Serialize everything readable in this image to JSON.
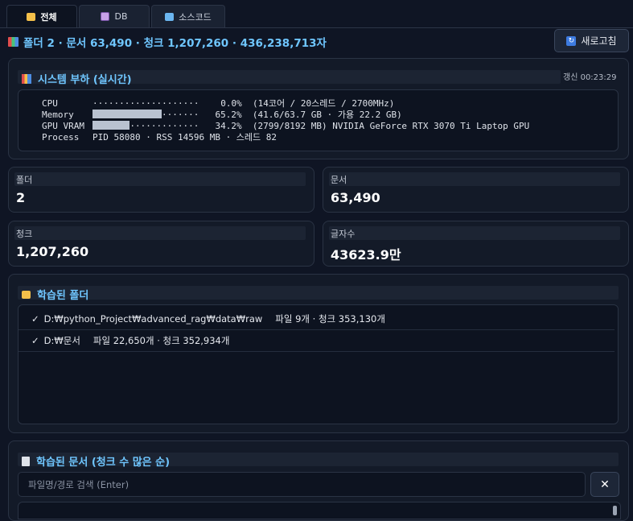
{
  "tabs": [
    {
      "label": "전체",
      "icon": "folder-icon",
      "active": true
    },
    {
      "label": "DB",
      "icon": "floppy-disk-icon",
      "active": false
    },
    {
      "label": "소스코드",
      "icon": "computer-icon",
      "active": false
    }
  ],
  "summary": {
    "text": "폴더 2 · 문서 63,490 · 청크 1,207,260 · 436,238,713자",
    "icon": "books-icon"
  },
  "refresh_button": {
    "label": "새로고침",
    "icon": "refresh-icon"
  },
  "system_load": {
    "title": "시스템 부하 (실시간)",
    "icon": "bar-chart-icon",
    "updated": "갱신 00:23:29",
    "cpu": {
      "label": "CPU",
      "percent": "0.0%",
      "level": 0.0,
      "detail": "(14코어 / 20스레드 / 2700MHz)"
    },
    "memory": {
      "label": "Memory",
      "percent": "65.2%",
      "level": 0.652,
      "detail": "(41.6/63.7 GB · 가용 22.2 GB)"
    },
    "gpu": {
      "label": "GPU VRAM",
      "percent": "34.2%",
      "level": 0.342,
      "detail": "(2799/8192 MB) NVIDIA GeForce RTX 3070 Ti Laptop GPU"
    },
    "process": {
      "label": "Process",
      "detail": "PID 58080 · RSS 14596 MB · 스레드 82"
    }
  },
  "stats": {
    "folders": {
      "label": "폴더",
      "value": "2"
    },
    "documents": {
      "label": "문서",
      "value": "63,490"
    },
    "chunks": {
      "label": "청크",
      "value": "1,207,260"
    },
    "chars": {
      "label": "글자수",
      "value": "43623.9만"
    }
  },
  "learned_folders": {
    "title": "학습된 폴더",
    "icon": "folder-icon",
    "items": [
      {
        "check": "✓",
        "path": "D:₩python_Project₩advanced_rag₩data₩raw",
        "info": "파일 9개 · 청크 353,130개"
      },
      {
        "check": "✓",
        "path": "D:₩문서",
        "info": "파일 22,650개 · 청크 352,934개"
      }
    ]
  },
  "learned_documents": {
    "title": "학습된 문서 (청크 수 많은 순)",
    "icon": "document-icon",
    "search_placeholder": "파일명/경로 검색 (Enter)",
    "search_value": "",
    "clear_label": "✕"
  },
  "colors": {
    "accent": "#6fc6ff",
    "background": "#0f1524",
    "panel": "#131a28"
  }
}
